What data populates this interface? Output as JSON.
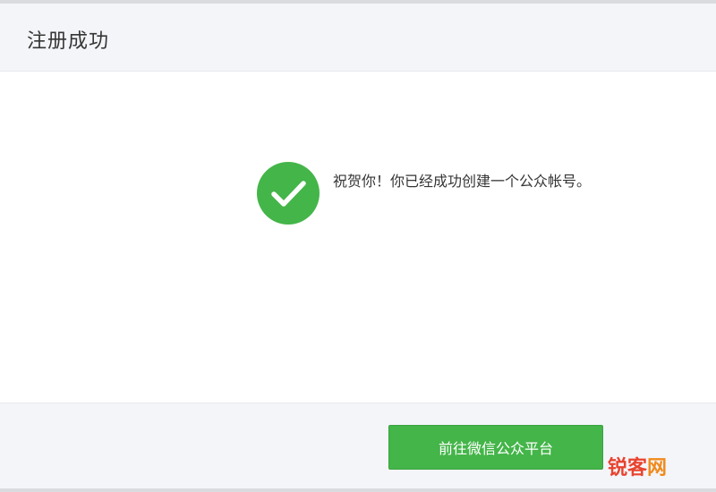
{
  "header": {
    "title": "注册成功"
  },
  "main": {
    "icon": "check-circle-icon",
    "message": "祝贺你！你已经成功创建一个公众帐号。"
  },
  "footer": {
    "button_label": "前往微信公众平台"
  },
  "watermark": {
    "part1": "锐客",
    "part2": "网"
  },
  "colors": {
    "accent": "#44b549",
    "panel_bg": "#f4f5f9",
    "text": "#353535",
    "watermark_red": "#e8432e",
    "watermark_orange": "#f08a1c"
  }
}
